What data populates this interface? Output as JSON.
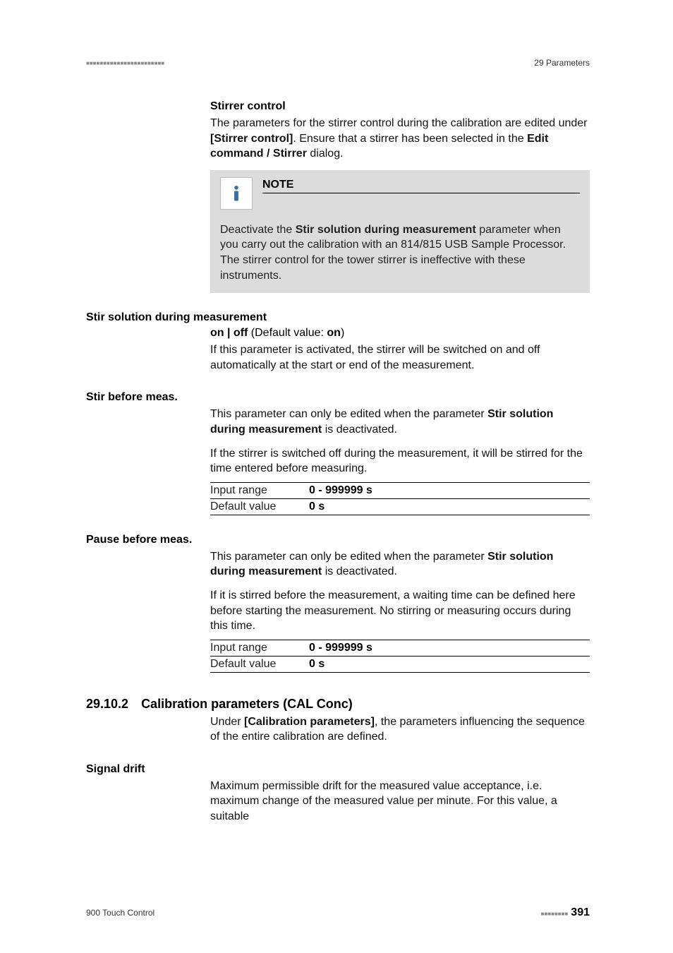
{
  "header": {
    "dashes": "■■■■■■■■■■■■■■■■■■■■■■■",
    "right": "29 Parameters"
  },
  "stirrer": {
    "heading": "Stirrer control",
    "para_before_1": "The parameters for the stirrer control during the calibration are edited under ",
    "para_b1": "[Stirrer control]",
    "para_mid": ". Ensure that a stirrer has been selected in the ",
    "para_b2": "Edit command / Stirrer",
    "para_after": " dialog."
  },
  "note": {
    "title": "NOTE",
    "body_before": "Deactivate the ",
    "body_b": "Stir solution during measurement",
    "body_after": " parameter when you carry out the calibration with an 814/815 USB Sample Processor. The stirrer control for the tower stirrer is ineffective with these instruments."
  },
  "p1": {
    "heading": "Stir solution during measurement",
    "onoff_b": "on | off",
    "onoff_mid": " (Default value: ",
    "onoff_b2": "on",
    "onoff_after": ")",
    "desc": "If this parameter is activated, the stirrer will be switched on and off automatically at the start or end of the measurement."
  },
  "p2": {
    "heading": "Stir before meas.",
    "desc_before": "This parameter can only be edited when the parameter ",
    "desc_b": "Stir solution during measurement",
    "desc_after": " is deactivated.",
    "desc2": "If the stirrer is switched off during the measurement, it will be stirred for the time entered before measuring.",
    "row1_label": "Input range",
    "row1_value": "0 - 999999 s",
    "row2_label": "Default value",
    "row2_value": "0 s"
  },
  "p3": {
    "heading": "Pause before meas.",
    "desc_before": "This parameter can only be edited when the parameter ",
    "desc_b": "Stir solution during measurement",
    "desc_after": " is deactivated.",
    "desc2": "If it is stirred before the measurement, a waiting time can be defined here before starting the measurement. No stirring or measuring occurs during this time.",
    "row1_label": "Input range",
    "row1_value": "0 - 999999 s",
    "row2_label": "Default value",
    "row2_value": "0 s"
  },
  "section": {
    "num": "29.10.2",
    "title": "Calibration parameters (CAL Conc)",
    "body_before": "Under ",
    "body_b": "[Calibration parameters]",
    "body_after": ", the parameters influencing the sequence of the entire calibration are defined."
  },
  "p4": {
    "heading": "Signal drift",
    "desc": "Maximum permissible drift for the measured value acceptance, i.e. maximum change of the measured value per minute. For this value, a suitable"
  },
  "footer": {
    "left": "900 Touch Control",
    "dashes": "■■■■■■■■",
    "page": "391"
  }
}
